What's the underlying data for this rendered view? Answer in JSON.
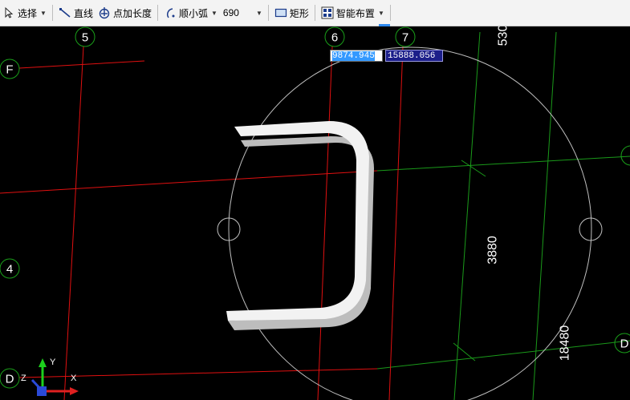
{
  "toolbar": {
    "select_label": "选择",
    "line_label": "直线",
    "point_length_label": "点加长度",
    "arc_label": "顺小弧",
    "arc_value": "690",
    "rect_label": "矩形",
    "smart_label": "智能布置"
  },
  "coords": {
    "x_value": "9874.945",
    "y_value": "15888.056"
  },
  "axes": {
    "col_5": "5",
    "col_6": "6",
    "col_7": "7",
    "row_F": "F",
    "row_4": "4",
    "row_D_left": "D",
    "row_D_right": "D"
  },
  "dimensions": {
    "top_dim": "530",
    "mid_dim": "3880",
    "bottom_dim": "18480"
  },
  "ucs": {
    "y_label": "Y",
    "x_label": "X",
    "z_label": "Z"
  },
  "colors": {
    "grid_red": "#e01010",
    "grid_green": "#1a9a1a",
    "bubble_green": "#1aa01a",
    "label_white": "#ffffff",
    "rebar_light": "#f2f2f2",
    "rebar_side": "#bdbdbd",
    "circle_gray": "#bfbfbf"
  }
}
